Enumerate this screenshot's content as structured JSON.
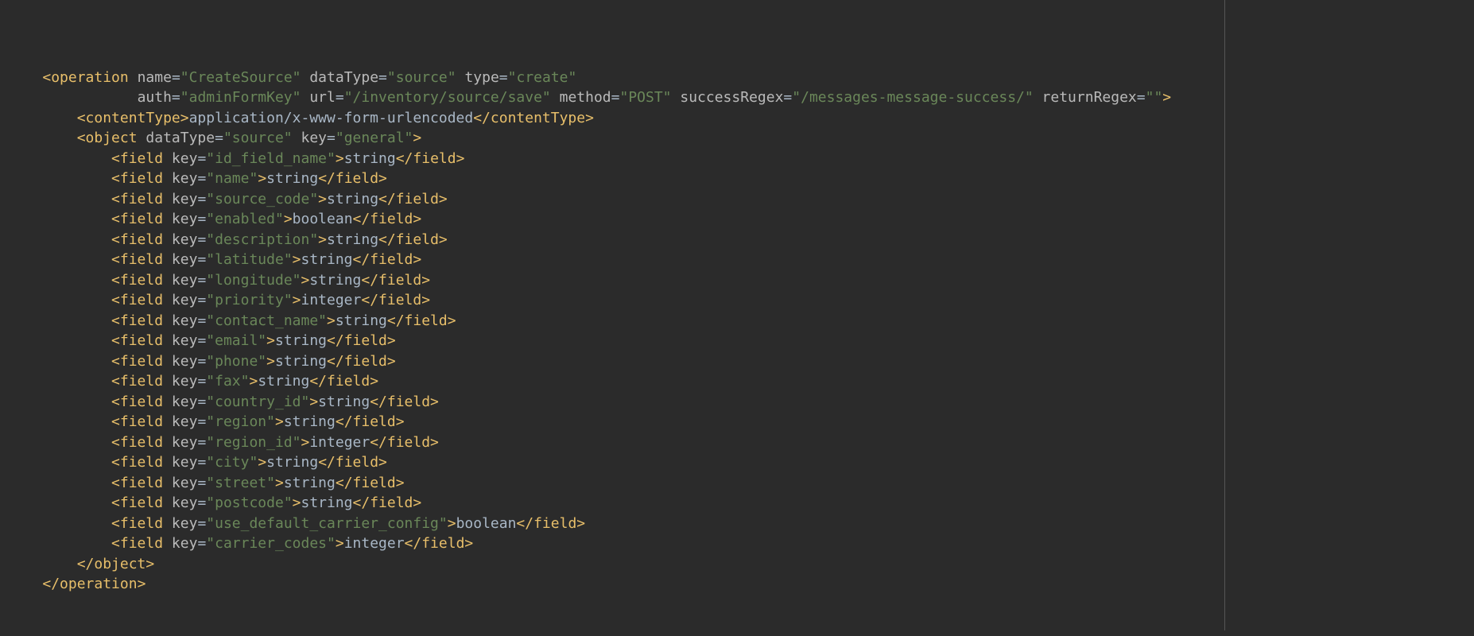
{
  "operation": {
    "tag": "operation",
    "attrs1": {
      "name": {
        "k": "name",
        "v": "\"CreateSource\""
      },
      "dataType": {
        "k": "dataType",
        "v": "\"source\""
      },
      "type": {
        "k": "type",
        "v": "\"create\""
      }
    },
    "attrs2": {
      "auth": {
        "k": "auth",
        "v": "\"adminFormKey\""
      },
      "url": {
        "k": "url",
        "v": "\"/inventory/source/save\""
      },
      "method": {
        "k": "method",
        "v": "\"POST\""
      },
      "successRegex": {
        "k": "successRegex",
        "v": "\"/messages-message-success/\""
      },
      "returnRegex": {
        "k": "returnRegex",
        "v": "\"\""
      }
    },
    "open_end": ">",
    "close": "</operation>"
  },
  "contentType": {
    "open": "<contentType>",
    "value": "application/x-www-form-urlencoded",
    "close": "</contentType>"
  },
  "object": {
    "tag": "object",
    "attrs": {
      "dataType": {
        "k": "dataType",
        "v": "\"source\""
      },
      "key": {
        "k": "key",
        "v": "\"general\""
      }
    },
    "open_end": ">",
    "close": "</object>"
  },
  "field_tag_open_start": "<field",
  "field_attr_key": "key",
  "field_open_end": ">",
  "field_close": "</field>",
  "fields": [
    {
      "key": "\"id_field_name\"",
      "val": "string"
    },
    {
      "key": "\"name\"",
      "val": "string"
    },
    {
      "key": "\"source_code\"",
      "val": "string"
    },
    {
      "key": "\"enabled\"",
      "val": "boolean"
    },
    {
      "key": "\"description\"",
      "val": "string"
    },
    {
      "key": "\"latitude\"",
      "val": "string"
    },
    {
      "key": "\"longitude\"",
      "val": "string"
    },
    {
      "key": "\"priority\"",
      "val": "integer"
    },
    {
      "key": "\"contact_name\"",
      "val": "string"
    },
    {
      "key": "\"email\"",
      "val": "string"
    },
    {
      "key": "\"phone\"",
      "val": "string"
    },
    {
      "key": "\"fax\"",
      "val": "string"
    },
    {
      "key": "\"country_id\"",
      "val": "string"
    },
    {
      "key": "\"region\"",
      "val": "string"
    },
    {
      "key": "\"region_id\"",
      "val": "integer"
    },
    {
      "key": "\"city\"",
      "val": "string"
    },
    {
      "key": "\"street\"",
      "val": "string"
    },
    {
      "key": "\"postcode\"",
      "val": "string"
    },
    {
      "key": "\"use_default_carrier_config\"",
      "val": "boolean"
    },
    {
      "key": "\"carrier_codes\"",
      "val": "integer"
    }
  ],
  "lt": "<",
  "eq": "="
}
